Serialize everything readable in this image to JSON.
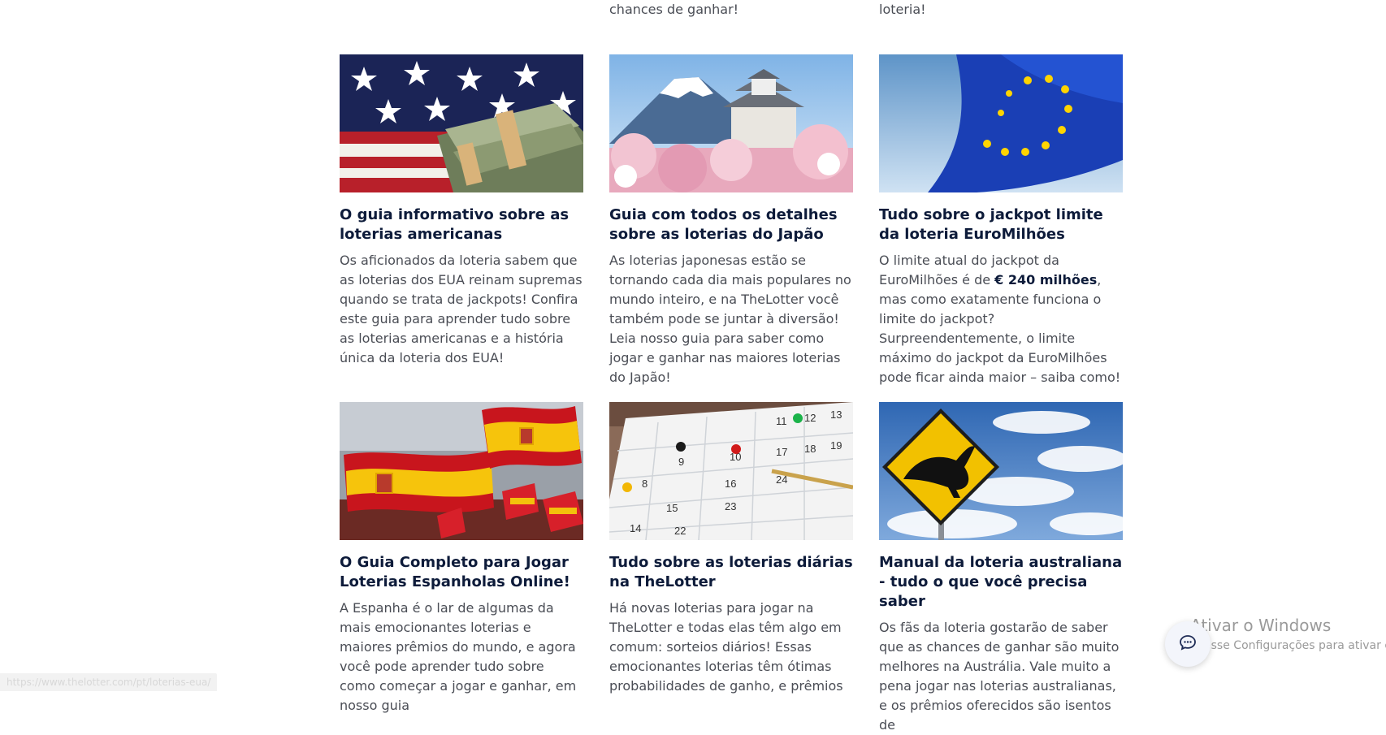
{
  "top_fragments": [
    "chances de ganhar!",
    "loteria!"
  ],
  "cards": [
    {
      "title": "O guia informativo sobre as loterias americanas",
      "description": "Os aficionados da loteria sabem que as loterias dos EUA reinam supremas quando se trata de jackpots! Confira este guia para aprender tudo sobre as loterias americanas e a história única da loteria dos EUA!",
      "image_icon": "usa-flag-money-image"
    },
    {
      "title": "Guia com todos os detalhes sobre as loterias do Japão",
      "description": "As loterias japonesas estão se tornando cada dia mais populares no mundo inteiro, e na TheLotter você também pode se juntar à diversão! Leia nosso guia para saber como jogar e ganhar nas maiores loterias do Japão!",
      "image_icon": "mount-fuji-castle-image"
    },
    {
      "title": "Tudo sobre o jackpot limite da loteria EuroMilhões",
      "description_parts": {
        "before": "O limite atual do jackpot da EuroMilhões é de ",
        "bold": "€ 240 milhões",
        "after": ", mas como exatamente funciona o limite do jackpot? Surpreendentemente, o limite máximo do jackpot da EuroMilhões pode ficar ainda maior – saiba como!"
      },
      "image_icon": "eu-flag-image"
    },
    {
      "title": "O Guia Completo para Jogar Loterias Espanholas Online!",
      "description": "A Espanha é o lar de algumas da mais emocionantes loterias e maiores prêmios do mundo, e agora você pode aprender tudo sobre como começar a jogar e ganhar, em nosso guia",
      "image_icon": "spain-flags-image"
    },
    {
      "title": "Tudo sobre as loterias diárias na TheLotter",
      "description": "Há novas loterias para jogar na TheLotter e todas elas têm algo em comum: sorteios diários! Essas emocionantes loterias têm ótimas probabilidades de ganho, e prêmios",
      "image_icon": "calendar-pins-image",
      "calendar_numbers": [
        "11",
        "12",
        "13",
        "9",
        "10",
        "17",
        "18",
        "19",
        "8",
        "16",
        "24",
        "15",
        "23",
        "14",
        "22"
      ]
    },
    {
      "title": "Manual da loteria australiana - tudo o que você precisa saber",
      "description": "Os fãs da loteria gostarão de saber que as chances de ganhar são muito melhores na Austrália. Vale muito a pena jogar nas loterias australianas, e os prêmios oferecidos são isentos de",
      "image_icon": "kangaroo-sign-image"
    }
  ],
  "status_bar_url": "https://www.thelotter.com/pt/loterias-eua/",
  "chat_button_icon": "chat-icon",
  "windows_watermark": {
    "line1": "Ativar o Windows",
    "line2": "Acesse Configurações para ativar o Windows."
  }
}
